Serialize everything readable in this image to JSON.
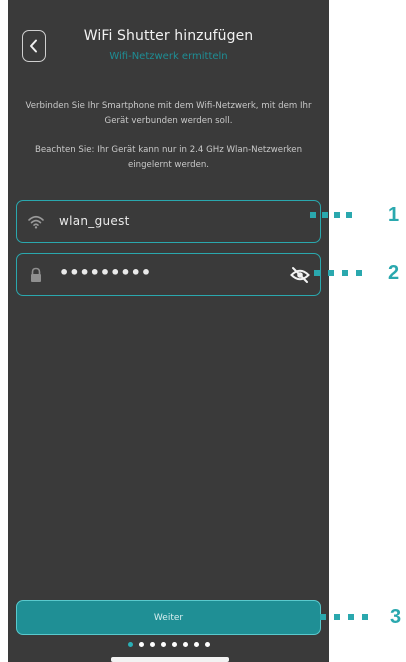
{
  "header": {
    "title": "WiFi Shutter hinzufügen",
    "subtitle": "Wifi-Netzwerk ermitteln"
  },
  "info": {
    "line1": "Verbinden Sie Ihr Smartphone mit dem Wifi-Netzwerk, mit dem Ihr Gerät verbunden werden soll.",
    "line2": "Beachten Sie: Ihr Gerät kann nur in 2.4 GHz Wlan-Netzwerken eingelernt werden."
  },
  "ssid_field": {
    "value": "wlan_guest",
    "icon": "wifi-icon"
  },
  "password_field": {
    "value": "•••••••••",
    "icon": "lock-icon",
    "toggle_icon": "eye-slash-icon"
  },
  "next_button": {
    "label": "Weiter"
  },
  "pager": {
    "total": 8,
    "current": 1
  },
  "callouts": [
    {
      "label": "1"
    },
    {
      "label": "2"
    },
    {
      "label": "3"
    }
  ],
  "colors": {
    "accent": "#2aa8ae",
    "background": "#3a3a3a",
    "button": "#1f8f95"
  }
}
